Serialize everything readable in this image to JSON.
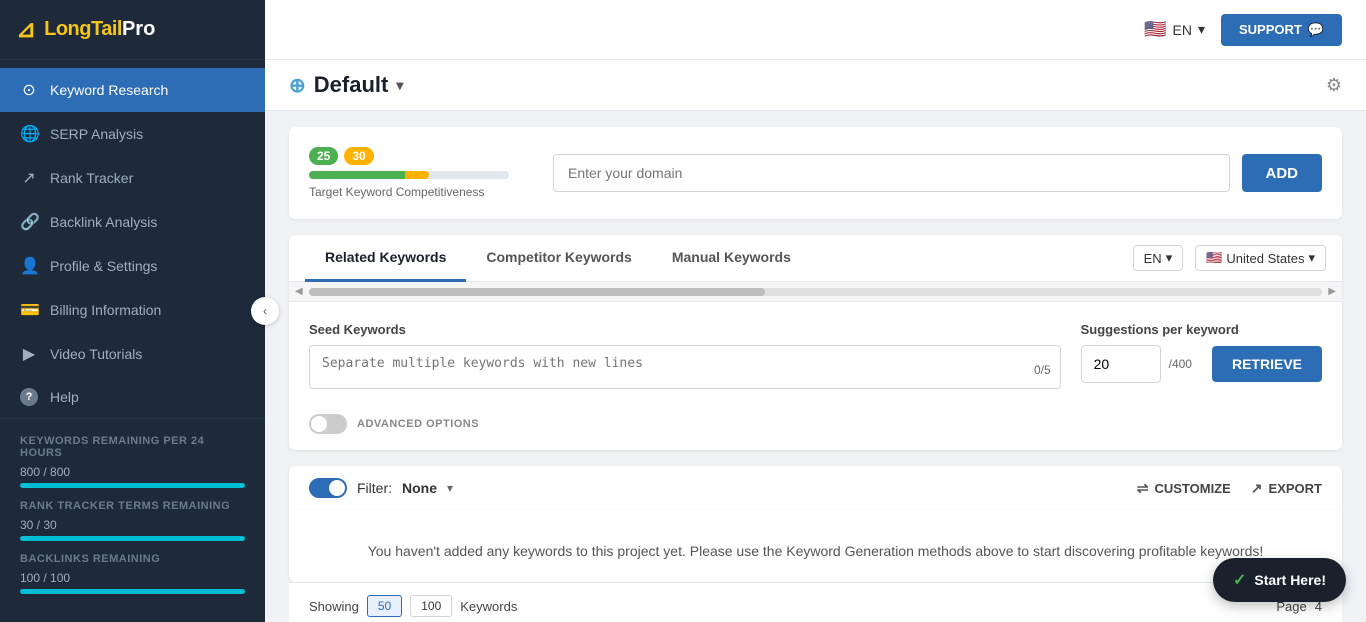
{
  "sidebar": {
    "logo": "LongTailPro",
    "logo_part1": "Long",
    "logo_part2": "Tail",
    "logo_part3": "Pro",
    "toggle_icon": "‹",
    "nav_items": [
      {
        "id": "keyword-research",
        "label": "Keyword Research",
        "icon": "⊙",
        "active": true
      },
      {
        "id": "serp-analysis",
        "label": "SERP Analysis",
        "icon": "🌐",
        "active": false
      },
      {
        "id": "rank-tracker",
        "label": "Rank Tracker",
        "icon": "↗",
        "active": false
      },
      {
        "id": "backlink-analysis",
        "label": "Backlink Analysis",
        "icon": "🔗",
        "active": false
      },
      {
        "id": "profile-settings",
        "label": "Profile & Settings",
        "icon": "👤",
        "active": false
      },
      {
        "id": "billing-information",
        "label": "Billing Information",
        "icon": "💳",
        "active": false
      },
      {
        "id": "video-tutorials",
        "label": "Video Tutorials",
        "icon": "▶",
        "active": false
      },
      {
        "id": "help",
        "label": "Help",
        "icon": "?",
        "active": false
      }
    ],
    "footer": {
      "keywords_label": "Keywords Remaining per 24 hours",
      "keywords_stat": "800 / 800",
      "keywords_progress": 100,
      "rank_label": "Rank Tracker Terms Remaining",
      "rank_stat": "30 / 30",
      "rank_progress": 100,
      "backlinks_label": "Backlinks Remaining",
      "backlinks_stat": "100 / 100",
      "backlinks_progress": 100
    }
  },
  "topbar": {
    "lang": "EN",
    "lang_arrow": "▾",
    "support_label": "SUPPORT",
    "support_icon": "💬"
  },
  "project": {
    "add_icon": "⊕",
    "title": "Default",
    "arrow": "▾",
    "gear_icon": "⚙"
  },
  "domain_card": {
    "score_low": "25",
    "score_high": "30",
    "comp_label": "Target Keyword Competitiveness",
    "domain_placeholder": "Enter your domain",
    "add_button": "ADD"
  },
  "tabs": {
    "items": [
      {
        "id": "related",
        "label": "Related Keywords",
        "active": true
      },
      {
        "id": "competitor",
        "label": "Competitor Keywords",
        "active": false
      },
      {
        "id": "manual",
        "label": "Manual Keywords",
        "active": false
      }
    ],
    "lang_value": "EN",
    "lang_arrow": "▾",
    "country_value": "United States",
    "country_arrow": "▾"
  },
  "seed_section": {
    "seed_label": "Seed Keywords",
    "seed_placeholder": "Separate multiple keywords with new lines",
    "seed_count": "0/5",
    "suggestions_label": "Suggestions per keyword",
    "suggestions_value": "20",
    "suggestions_max": "/400",
    "retrieve_label": "RETRIEVE",
    "advanced_label": "ADVANCED OPTIONS"
  },
  "filter_section": {
    "filter_label": "Filter:",
    "filter_value": "None",
    "filter_arrow": "▾",
    "customize_label": "CUSTOMIZE",
    "export_label": "EXPORT",
    "customize_icon": "⇌",
    "export_icon": "↗"
  },
  "empty_state": {
    "text": "You haven't added any keywords to this project yet. Please use the Keyword Generation methods above to start discovering profitable keywords!"
  },
  "show_row": {
    "showing_label": "Showing",
    "btn_50": "50",
    "btn_100": "100",
    "keywords_label": "Keywords",
    "page_label": "Page",
    "page_number": "4"
  },
  "start_here": {
    "label": "Start Here!",
    "icon": "✓"
  }
}
